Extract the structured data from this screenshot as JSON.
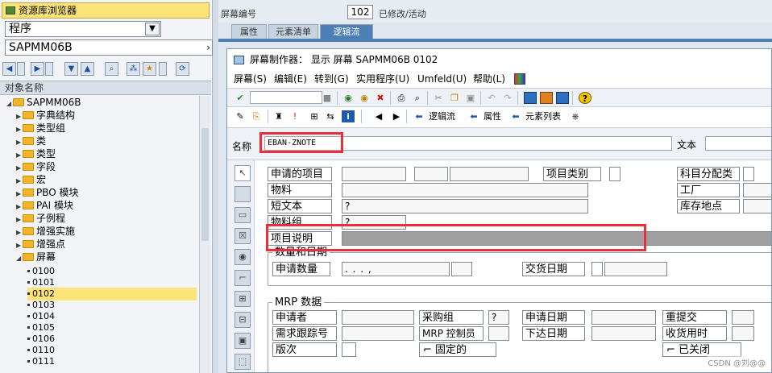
{
  "left_panel": {
    "title": "资源库浏览器",
    "object_type": "程序",
    "object_name": "SAPMM06B",
    "column_header": "对象名称",
    "tree": {
      "root": "SAPMM06B",
      "folders": [
        "字典结构",
        "类型组",
        "类",
        "类型",
        "字段",
        "宏",
        "PBO 模块",
        "PAI 模块",
        "子例程",
        "增强实施",
        "增强点",
        "屏幕"
      ],
      "screens": [
        "0100",
        "0101",
        "0102",
        "0103",
        "0104",
        "0105",
        "0106",
        "0110",
        "0111"
      ],
      "selected_screen": "0102"
    }
  },
  "header": {
    "screen_no_label": "屏幕编号",
    "screen_no": "102",
    "status": "已修改/活动",
    "tabs": [
      {
        "label": "属性",
        "active": false
      },
      {
        "label": "元素清单",
        "active": false
      },
      {
        "label": "逻辑流",
        "active": true
      }
    ]
  },
  "painter": {
    "title": "屏幕制作器： 显示 屏幕 SAPMM06B 0102",
    "menu": [
      "屏幕(S)",
      "编辑(E)",
      "转到(G)",
      "实用程序(U)",
      "Umfeld(U)",
      "帮助(L)"
    ],
    "toolbar2": {
      "flow_logic": "逻辑流",
      "attributes": "属性",
      "element_list": "元素列表"
    },
    "name_label": "名称",
    "name_value": "EBAN-ZNOTE",
    "text_label": "文本"
  },
  "canvas": {
    "labels": {
      "req_item": "申请的项目",
      "item_cat": "项目类别",
      "acct_assign": "科目分配类",
      "material": "物料",
      "plant": "工厂",
      "short_text": "短文本",
      "stor_loc": "库存地点",
      "mat_group": "物料组",
      "item_desc": "项目说明",
      "qty_date_frame": "数量和日期",
      "req_qty": "申请数量",
      "deliv_date": "交货日期",
      "mrp_frame": "MRP 数据",
      "requisitioner": "申请者",
      "purch_group": "采购组",
      "req_date": "申请日期",
      "resubmit": "重提交",
      "tracking_no": "需求跟踪号",
      "mrp_controller": "MRP 控制员",
      "release_date": "下达日期",
      "gr_time": "收货用时",
      "version": "版次",
      "fixed": "固定的",
      "closed": "已关闭"
    },
    "values": {
      "short_text_q": "?",
      "mat_group_q": "?",
      "purch_group_q": "?",
      "qty_mask": ".    .    .    ,"
    }
  },
  "watermark": "CSDN @刘@@",
  "icons": [
    "folder-icon",
    "expand-arrow-icon",
    "collapse-arrow-icon",
    "check-icon",
    "save-icon",
    "back-icon",
    "exit-icon",
    "cancel-icon",
    "print-icon",
    "find-icon",
    "cut-icon",
    "copy-icon",
    "paste-icon",
    "help-icon",
    "prev-icon",
    "next-icon"
  ],
  "colors": {
    "accent": "#4d7fb5",
    "selection": "#fde47a",
    "highlight": "#e8303a",
    "folder": "#f0b429"
  }
}
